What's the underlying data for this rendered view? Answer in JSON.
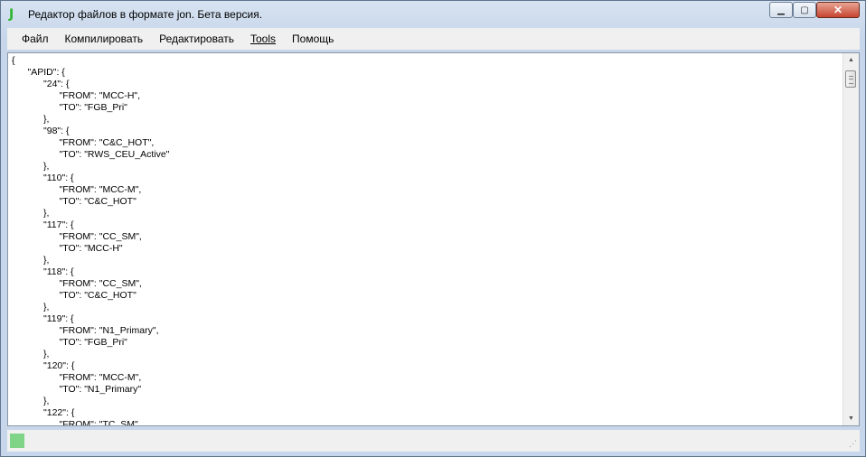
{
  "window": {
    "title": "Редактор файлов в формате jon. Бета версия.",
    "app_icon": "J",
    "controls": {
      "minimize": "▁",
      "maximize": "▢",
      "close": "✕"
    }
  },
  "menu": [
    {
      "label": "Файл"
    },
    {
      "label": "Компилировать"
    },
    {
      "label": "Редактировать"
    },
    {
      "label": "Tools"
    },
    {
      "label": "Помощь"
    }
  ],
  "editor": {
    "content": "{\n\t\"APID\": {\n\t\t\"24\": {\n\t\t\t\"FROM\": \"MCC-H\",\n\t\t\t\"TO\": \"FGB_Pri\"\n\t\t},\n\t\t\"98\": {\n\t\t\t\"FROM\": \"C&C_HOT\",\n\t\t\t\"TO\": \"RWS_CEU_Active\"\n\t\t},\n\t\t\"110\": {\n\t\t\t\"FROM\": \"MCC-M\",\n\t\t\t\"TO\": \"C&C_HOT\"\n\t\t},\n\t\t\"117\": {\n\t\t\t\"FROM\": \"CC_SM\",\n\t\t\t\"TO\": \"MCC-H\"\n\t\t},\n\t\t\"118\": {\n\t\t\t\"FROM\": \"CC_SM\",\n\t\t\t\"TO\": \"C&C_HOT\"\n\t\t},\n\t\t\"119\": {\n\t\t\t\"FROM\": \"N1_Primary\",\n\t\t\t\"TO\": \"FGB_Pri\"\n\t\t},\n\t\t\"120\": {\n\t\t\t\"FROM\": \"MCC-M\",\n\t\t\t\"TO\": \"N1_Primary\"\n\t\t},\n\t\t\"122\": {\n\t\t\t\"FROM\": \"TC_SM\","
  },
  "scrollbar": {
    "up_arrow": "▲",
    "down_arrow": "▼"
  },
  "status": {
    "indicator_color": "#7fd487",
    "grip": "⋰"
  }
}
